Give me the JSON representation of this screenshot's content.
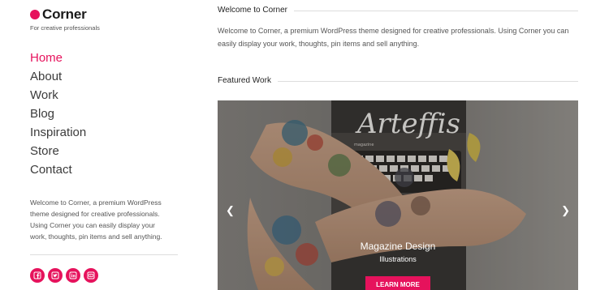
{
  "brand": {
    "name": "Corner",
    "tagline": "For creative professionals"
  },
  "nav": {
    "items": [
      {
        "label": "Home"
      },
      {
        "label": "About"
      },
      {
        "label": "Work"
      },
      {
        "label": "Blog"
      },
      {
        "label": "Inspiration"
      },
      {
        "label": "Store"
      },
      {
        "label": "Contact"
      }
    ]
  },
  "sidebar": {
    "about_text": "Welcome to Corner, a premium WordPress theme designed for creative professionals. Using Corner you can easily display your work, thoughts, pin items and sell anything.",
    "socials": [
      "facebook-icon",
      "twitter-icon",
      "linkedin-icon",
      "youtube-icon"
    ]
  },
  "main": {
    "welcome_heading": "Welcome to Corner",
    "welcome_text": "Welcome to Corner, a premium WordPress theme designed for creative professionals. Using Corner you can easily display your work, thoughts, pin items and sell anything.",
    "featured_heading": "Featured Work"
  },
  "slider": {
    "prev_icon": "chevron-left-icon",
    "next_icon": "chevron-right-icon",
    "caption_title": "Magazine Design",
    "caption_subtitle": "Illustrations",
    "button_label": "LEARN MORE",
    "magazine_title": "Arteffis",
    "magazine_small": "magazine"
  },
  "colors": {
    "accent": "#e6125c",
    "text": "#444444",
    "rule": "#dddddd"
  }
}
